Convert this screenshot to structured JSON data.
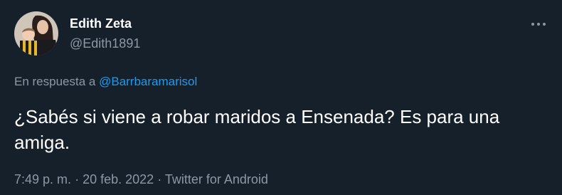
{
  "author": {
    "display_name": "Edith Zeta",
    "handle": "@Edith1891"
  },
  "reply": {
    "prefix": "En respuesta a",
    "mention": "@Barrbaramarisol"
  },
  "tweet": {
    "text": "¿Sabés si viene a robar maridos a Ensenada? Es para una amiga."
  },
  "meta": {
    "time": "7:49 p. m.",
    "date": "20 feb. 2022",
    "separator": "·",
    "source": "Twitter for Android"
  },
  "icons": {
    "more": "more-dots-icon",
    "avatar": "profile-photo"
  },
  "colors": {
    "background": "#15202b",
    "primary_text": "#ffffff",
    "secondary_text": "#8b98a5",
    "link": "#1d9bf0"
  }
}
